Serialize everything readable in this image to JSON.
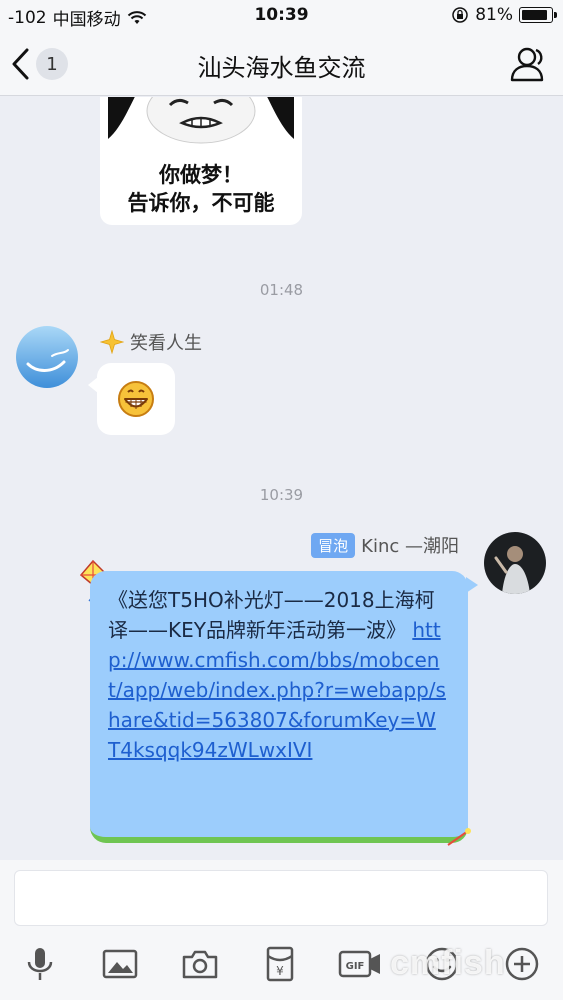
{
  "status_bar": {
    "signal": "-102",
    "carrier": "中国移动",
    "time": "10:39",
    "battery": "81%"
  },
  "nav": {
    "back_badge": "1",
    "title": "汕头海水鱼交流",
    "icons": {
      "back": "chevron-left-icon",
      "members": "person-icon"
    }
  },
  "messages": [
    {
      "type": "sticker",
      "caption_line1": "你做梦！",
      "caption_line2": "告诉你，不可能"
    },
    {
      "type": "timestamp",
      "text": "01:48"
    },
    {
      "type": "incoming",
      "sender": "笑看人生",
      "content": "grinning-emoji"
    },
    {
      "type": "timestamp",
      "text": "10:39"
    },
    {
      "type": "outgoing",
      "tag": "冒泡",
      "sender": "Kinc —潮阳",
      "text": "《送您T5HO补光灯——2018上海柯译——KEY品牌新年活动第一波》",
      "link": "http://www.cmfish.com/bbs/mobcent/app/web/index.php?r=webapp/share&tid=563807&forumKey=WT4ksqqk94zWLwxIVI"
    }
  ],
  "toolbar": {
    "icons": [
      "microphone-icon",
      "image-icon",
      "camera-icon",
      "red-packet-icon",
      "gif-icon",
      "emoji-icon",
      "plus-icon"
    ]
  },
  "watermark": "cmfish",
  "colors": {
    "bubble_blue": "#9ccdfc",
    "link": "#1e5fcf",
    "tag": "#6fa8f2"
  }
}
